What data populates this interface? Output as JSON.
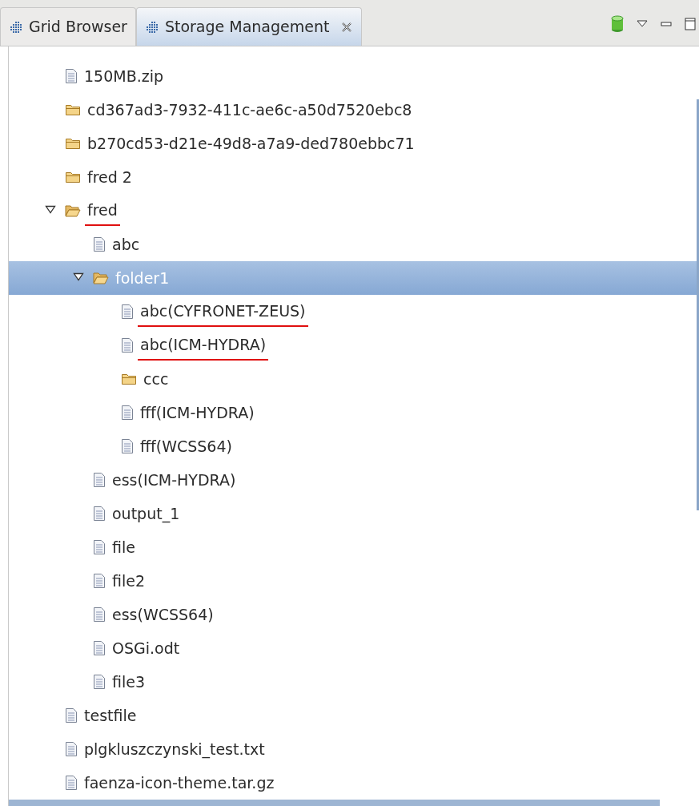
{
  "tabs": [
    {
      "label": "Grid Browser",
      "selected": false,
      "closable": false
    },
    {
      "label": "Storage Management",
      "selected": true,
      "closable": true
    }
  ],
  "tree": [
    {
      "kind": "file",
      "label": "150MB.zip",
      "selected": false,
      "underlined": false
    },
    {
      "kind": "folder",
      "label": "cd367ad3-7932-411c-ae6c-a50d7520ebc8",
      "selected": false,
      "underlined": false
    },
    {
      "kind": "folder",
      "label": "b270cd53-d21e-49d8-a7a9-ded780ebbc71",
      "selected": false,
      "underlined": false
    },
    {
      "kind": "folder",
      "label": "fred 2",
      "selected": false,
      "underlined": false
    },
    {
      "kind": "folder",
      "label": "fred",
      "selected": false,
      "underlined": true,
      "expanded": true,
      "children": [
        {
          "kind": "file",
          "label": "abc",
          "selected": false,
          "underlined": false
        },
        {
          "kind": "folder",
          "label": "folder1",
          "selected": true,
          "underlined": false,
          "expanded": true,
          "children": [
            {
              "kind": "file",
              "label": "abc(CYFRONET-ZEUS)",
              "selected": false,
              "underlined": true
            },
            {
              "kind": "file",
              "label": "abc(ICM-HYDRA)",
              "selected": false,
              "underlined": true
            },
            {
              "kind": "folder",
              "label": "ccc",
              "selected": false,
              "underlined": false
            },
            {
              "kind": "file",
              "label": "fff(ICM-HYDRA)",
              "selected": false,
              "underlined": false
            },
            {
              "kind": "file",
              "label": "fff(WCSS64)",
              "selected": false,
              "underlined": false
            }
          ]
        },
        {
          "kind": "file",
          "label": "ess(ICM-HYDRA)",
          "selected": false,
          "underlined": false
        },
        {
          "kind": "file",
          "label": "output_1",
          "selected": false,
          "underlined": false
        },
        {
          "kind": "file",
          "label": "file",
          "selected": false,
          "underlined": false
        },
        {
          "kind": "file",
          "label": "file2",
          "selected": false,
          "underlined": false
        },
        {
          "kind": "file",
          "label": "ess(WCSS64)",
          "selected": false,
          "underlined": false
        },
        {
          "kind": "file",
          "label": "OSGi.odt",
          "selected": false,
          "underlined": false
        },
        {
          "kind": "file",
          "label": "file3",
          "selected": false,
          "underlined": false
        }
      ]
    },
    {
      "kind": "file",
      "label": "testfile",
      "selected": false,
      "underlined": false
    },
    {
      "kind": "file",
      "label": "plgkluszczynski_test.txt",
      "selected": false,
      "underlined": false
    },
    {
      "kind": "file",
      "label": "faenza-icon-theme.tar.gz",
      "selected": false,
      "underlined": false
    }
  ]
}
